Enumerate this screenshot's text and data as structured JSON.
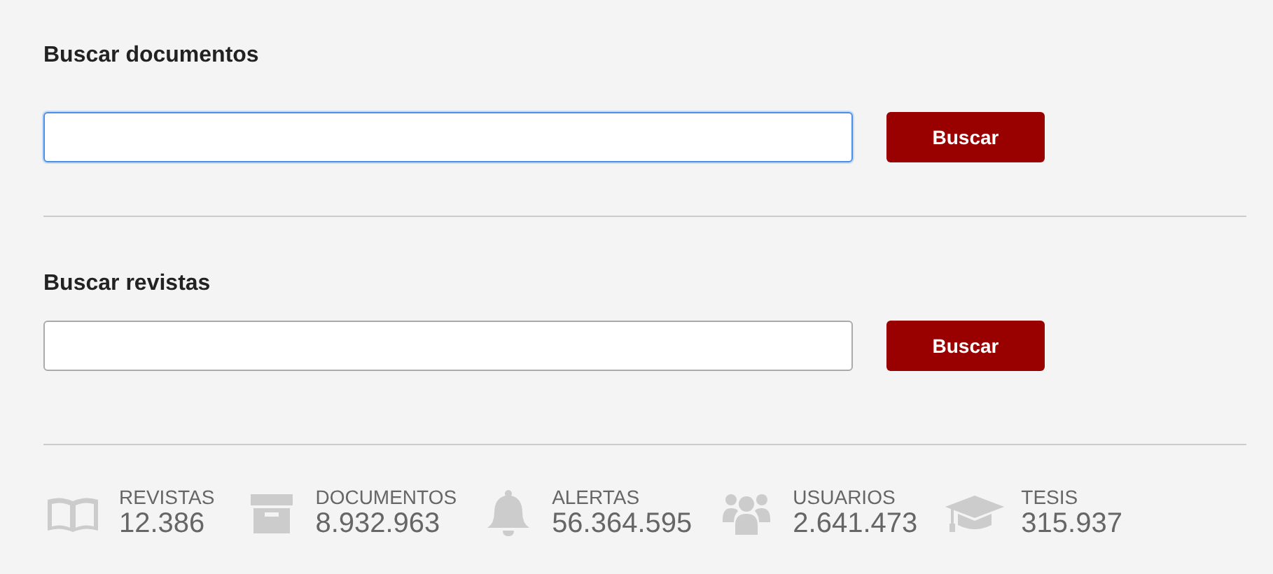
{
  "search_sections": [
    {
      "heading": "Buscar documentos",
      "field_focused": true,
      "button": "Buscar"
    },
    {
      "heading": "Buscar revistas",
      "field_focused": false,
      "button": "Buscar"
    }
  ],
  "stats": [
    {
      "kind": "book",
      "label": "REVISTAS",
      "value": "12.386"
    },
    {
      "kind": "box",
      "label": "DOCUMENTOS",
      "value": "8.932.963"
    },
    {
      "kind": "bell",
      "label": "ALERTAS",
      "value": "56.364.595"
    },
    {
      "kind": "users",
      "label": "USUARIOS",
      "value": "2.641.473"
    },
    {
      "kind": "cap",
      "label": "TESIS",
      "value": "315.937"
    }
  ]
}
